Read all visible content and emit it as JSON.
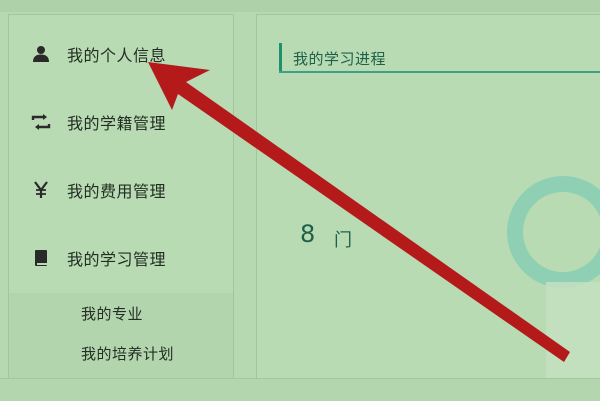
{
  "sidebar": {
    "items": [
      {
        "label": "我的个人信息",
        "icon": "user-icon"
      },
      {
        "label": "我的学籍管理",
        "icon": "transfer-icon"
      },
      {
        "label": "我的费用管理",
        "icon": "yen-icon"
      },
      {
        "label": "我的学习管理",
        "icon": "book-icon"
      }
    ],
    "subitems": [
      {
        "label": "我的专业"
      },
      {
        "label": "我的培养计划"
      }
    ]
  },
  "main": {
    "section_title": "我的学习进程",
    "progress": {
      "value": "8",
      "unit": "门"
    }
  },
  "colors": {
    "accent": "#1f8f6e",
    "ring": "#8fd0b4",
    "arrow": "#b51a1a",
    "background": "#b6d9b1"
  }
}
